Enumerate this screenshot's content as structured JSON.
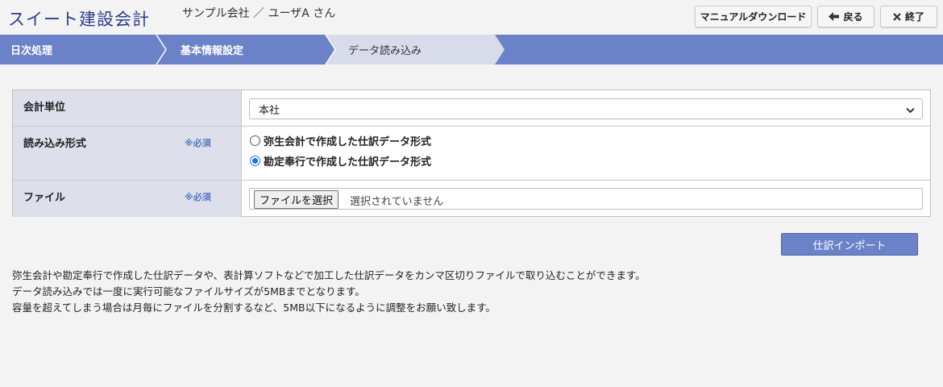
{
  "app": {
    "title": "スイート建設会計",
    "user_info": "サンプル会社 ／ ユーザA さん"
  },
  "header_buttons": {
    "manual_label": "マニュアルダウンロード",
    "back_label": "戻る",
    "exit_label": "終了",
    "back_icon": "arrow-left-icon",
    "exit_icon": "close-icon"
  },
  "breadcrumb": {
    "items": [
      {
        "label": "日次処理"
      },
      {
        "label": "基本情報設定"
      },
      {
        "label": "データ読み込み"
      }
    ],
    "bar_color": "#6c82c8",
    "active_color": "#d8dcea"
  },
  "form": {
    "unit": {
      "label": "会計単位",
      "selected": "本社"
    },
    "format": {
      "label": "読み込み形式",
      "required": "※必須",
      "options": [
        {
          "label": "弥生会計で作成した仕訳データ形式",
          "checked": false
        },
        {
          "label": "勘定奉行で作成した仕訳データ形式",
          "checked": true
        }
      ]
    },
    "file": {
      "label": "ファイル",
      "required": "※必須",
      "button_label": "ファイルを選択",
      "status": "選択されていません"
    }
  },
  "import_button": {
    "label": "仕訳インポート"
  },
  "notes": {
    "lines": [
      "弥生会計や勘定奉行で作成した仕訳データや、表計算ソフトなどで加工した仕訳データをカンマ区切りファイルで取り込むことができます。",
      "データ読み込みでは一度に実行可能なファイルサイズが5MBまでとなります。",
      "容量を超えてしまう場合は月毎にファイルを分割するなど、5MB以下になるように調整をお願い致します。"
    ]
  }
}
